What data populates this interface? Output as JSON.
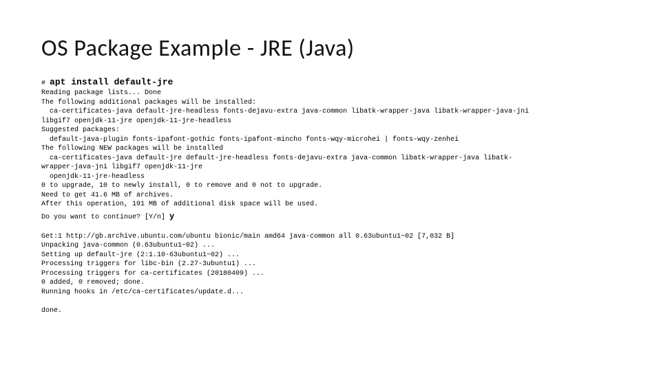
{
  "slide": {
    "title": "OS Package Example - JRE (Java)"
  },
  "terminal": {
    "prompt": "#",
    "command": "apt install default-jre",
    "block1": "Reading package lists... Done\nThe following additional packages will be installed:\n  ca-certificates-java default-jre-headless fonts-dejavu-extra java-common libatk-wrapper-java libatk-wrapper-java-jni\nlibgif7 openjdk-11-jre openjdk-11-jre-headless\nSuggested packages:\n  default-java-plugin fonts-ipafont-gothic fonts-ipafont-mincho fonts-wqy-microhei | fonts-wqy-zenhei\nThe following NEW packages will be installed\n  ca-certificates-java default-jre default-jre-headless fonts-dejavu-extra java-common libatk-wrapper-java libatk-\nwrapper-java-jni libgif7 openjdk-11-jre\n  openjdk-11-jre-headless\n0 to upgrade, 10 to newly install, 0 to remove and 0 not to upgrade.\nNeed to get 41.6 MB of archives.\nAfter this operation, 191 MB of additional disk space will be used.",
    "continue_prompt": "Do you want to continue? [Y/n]",
    "continue_answer": "y",
    "block2": "Get:1 http://gb.archive.ubuntu.com/ubuntu bionic/main amd64 java-common all 0.63ubuntu1~02 [7,032 B]\nUnpacking java-common (0.63ubuntu1~02) ...\nSetting up default-jre (2:1.10-63ubuntu1~02) ...\nProcessing triggers for libc-bin (2.27-3ubuntu1) ...\nProcessing triggers for ca-certificates (20180409) ...\n0 added, 0 removed; done.\nRunning hooks in /etc/ca-certificates/update.d...\n\ndone."
  }
}
